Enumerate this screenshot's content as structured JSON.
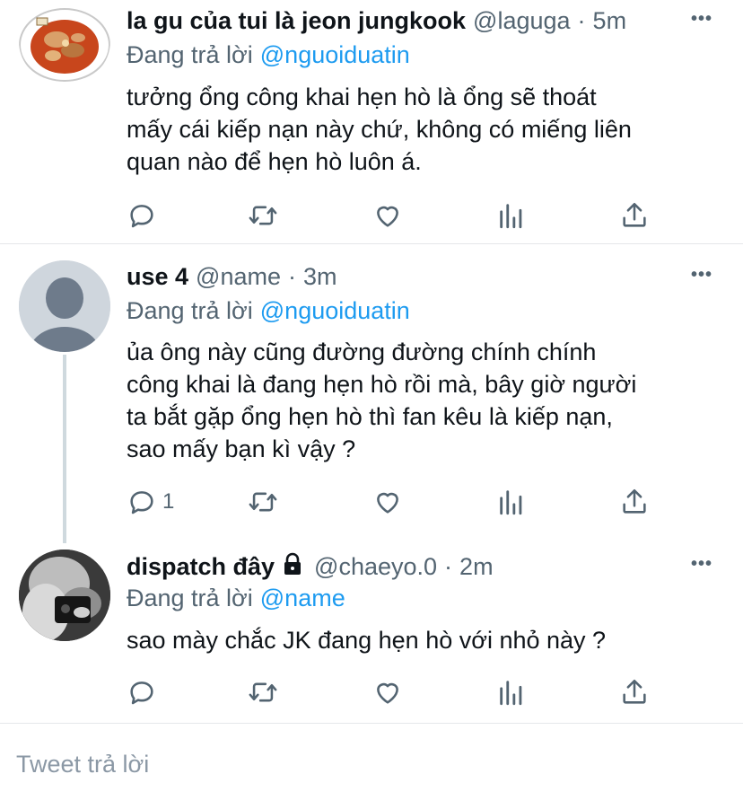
{
  "tweets": [
    {
      "display_name": "la gu của tui là jeon jungkook",
      "handle": "@laguga",
      "separator": "·",
      "time": "5m",
      "replying_label": "Đang trả lời",
      "replying_to": "@nguoiduatin",
      "lines": [
        "tưởng ổng công khai hẹn hò là ổng sẽ thoát",
        "mấy cái kiếp nạn này chứ, không có miếng liên",
        "quan nào để hẹn hò luôn á."
      ],
      "reply_count": ""
    },
    {
      "display_name": "use 4",
      "handle": "@name",
      "separator": "·",
      "time": "3m",
      "replying_label": "Đang trả lời",
      "replying_to": "@nguoiduatin",
      "lines": [
        "ủa ông này cũng đường đường chính chính",
        "công khai là đang hẹn hò rồi mà, bây giờ người",
        "ta bắt gặp ổng hẹn hò thì fan kêu là kiếp nạn,",
        "sao mấy bạn kì vậy ?"
      ],
      "reply_count": "1"
    },
    {
      "display_name": "dispatch đây",
      "handle": "@chaeyo.0",
      "separator": "·",
      "time": "2m",
      "replying_label": "Đang trả lời",
      "replying_to": "@name",
      "lines": [
        "sao mày chắc JK đang hẹn hò với nhỏ này ?"
      ],
      "reply_count": "",
      "protected": true
    }
  ],
  "more_icon": "more-dots-icon",
  "icons": [
    "reply-icon",
    "retweet-icon",
    "like-icon",
    "analytics-icon",
    "share-icon",
    "lock-icon"
  ],
  "compose_placeholder": "Tweet trả lời",
  "colors": {
    "link": "#1d9bf0",
    "secondary": "#536471",
    "divider": "#e5e7ea",
    "thread_line": "#cfd9de",
    "placeholder": "#8b98a5"
  }
}
